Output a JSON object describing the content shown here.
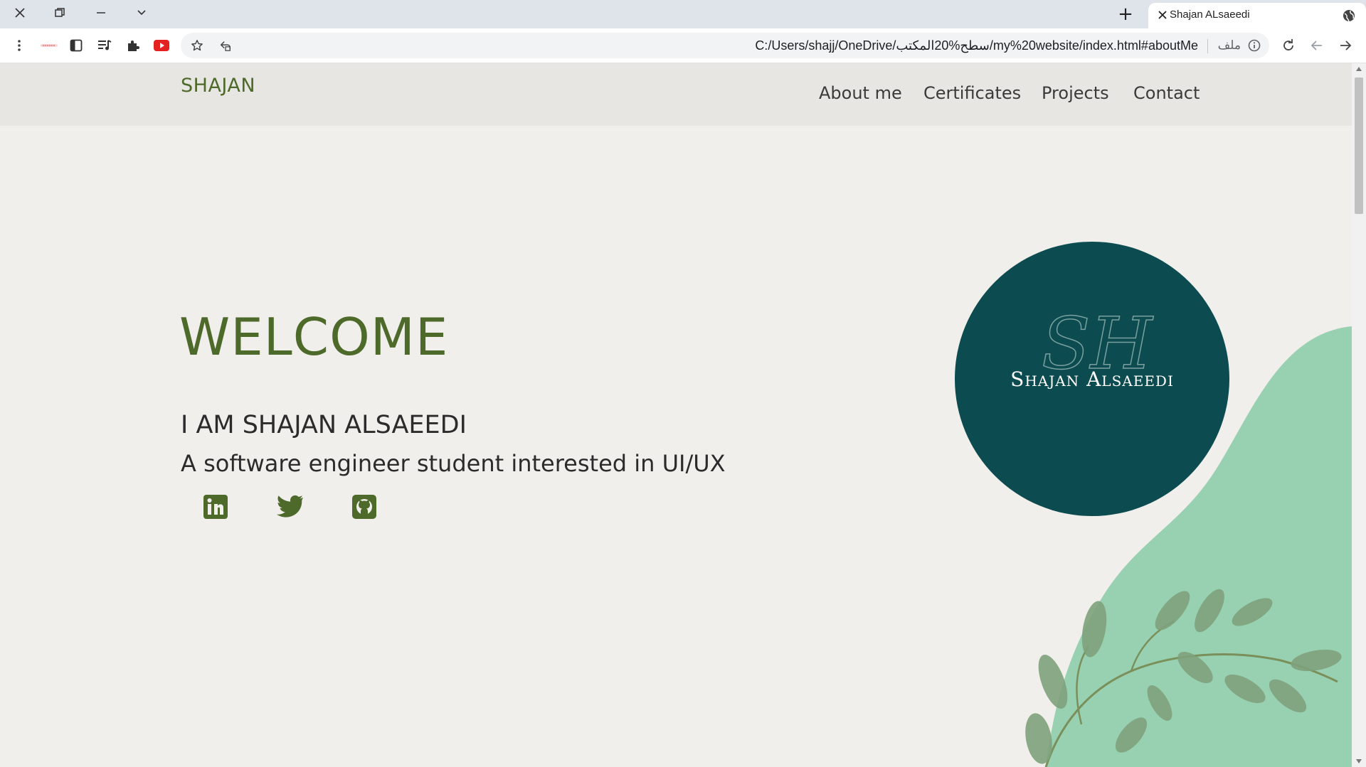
{
  "browser": {
    "tab_title": "Shajan ALsaeedi",
    "url": "C:/Users/shajj/OneDrive/سطح%20المكتب/my%20website/index.html#aboutMe",
    "url_scheme_label": "ملف",
    "new_tab_symbol": "+"
  },
  "site": {
    "logo": "SHAJAN",
    "nav": [
      "About me",
      "Certificates",
      "Projects",
      "Contact"
    ],
    "hero": {
      "welcome": "WELCOME",
      "intro": "I AM SHAJAN ALSAEEDI",
      "tagline": "A software engineer student interested in UI/UX"
    },
    "avatar": {
      "monogram": "SH",
      "name": "Shajan Alsaeedi"
    },
    "social_icons": [
      "linkedin-icon",
      "twitter-icon",
      "github-icon"
    ]
  },
  "colors": {
    "brand_green": "#4e6a2a",
    "avatar_teal": "#0c4b50",
    "blob_mint": "#98d1b1",
    "page_bg": "#f1efeb",
    "nav_bg": "#e8e6e2"
  }
}
